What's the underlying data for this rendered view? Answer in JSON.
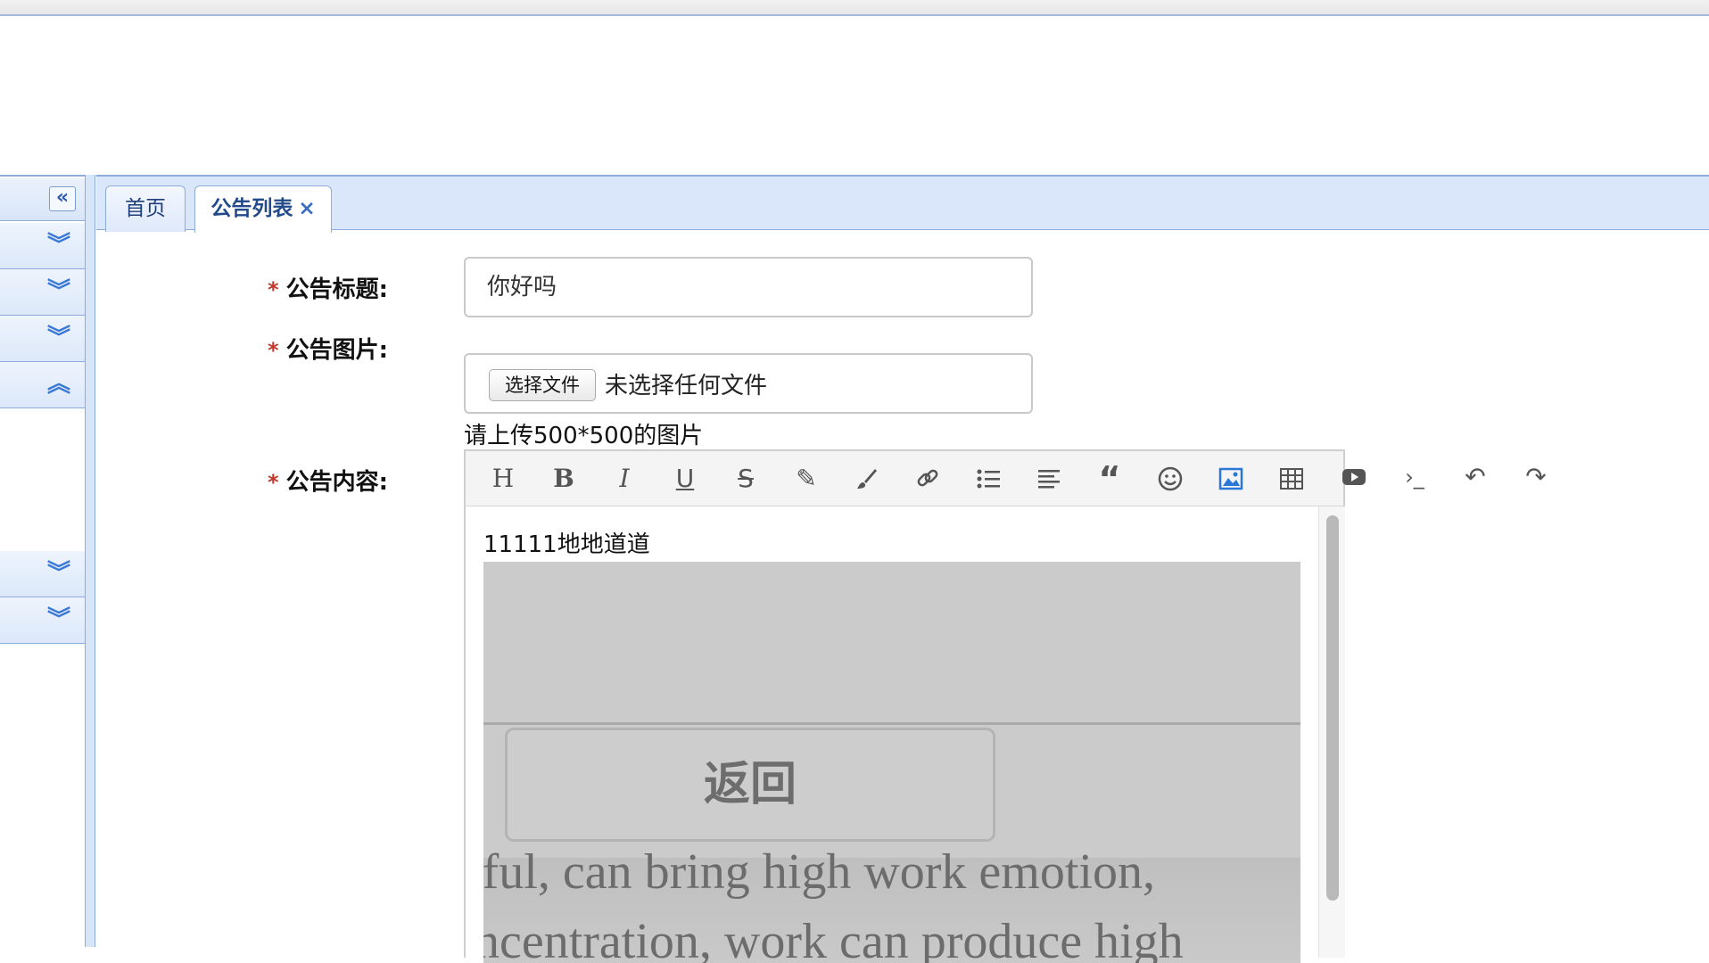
{
  "tabs": [
    {
      "label": "首页"
    },
    {
      "label": "公告列表",
      "close": "×"
    }
  ],
  "sidebar": {
    "collapse_icon": "double-chevron-left-icon",
    "items": [
      {
        "icon": "double-chevron-down-icon",
        "glyph": "⌄"
      },
      {
        "icon": "double-chevron-down-icon",
        "glyph": "⌄"
      },
      {
        "icon": "double-chevron-down-icon",
        "glyph": "⌄"
      },
      {
        "icon": "double-chevron-up-icon",
        "glyph": "⌃"
      },
      {
        "icon": "double-chevron-down-icon",
        "glyph": "⌄"
      },
      {
        "icon": "double-chevron-down-icon",
        "glyph": "⌄"
      }
    ]
  },
  "form": {
    "required_mark": "*",
    "title_label": "公告标题:",
    "title_value": "你好吗",
    "image_label": "公告图片:",
    "file_button": "选择文件",
    "file_status": "未选择任何文件",
    "image_hint": "请上传500*500的图片",
    "content_label": "公告内容:"
  },
  "editor": {
    "toolbar": [
      {
        "name": "heading-icon",
        "glyph": "H"
      },
      {
        "name": "bold-icon",
        "glyph": "B"
      },
      {
        "name": "italic-icon",
        "glyph": "I"
      },
      {
        "name": "underline-icon",
        "glyph": "U"
      },
      {
        "name": "strikethrough-icon",
        "glyph": "S"
      },
      {
        "name": "pen-icon",
        "glyph": "✎"
      },
      {
        "name": "brush-icon",
        "glyph": "🖌"
      },
      {
        "name": "link-icon",
        "glyph": "🔗"
      },
      {
        "name": "bullet-list-icon",
        "glyph": "☰"
      },
      {
        "name": "align-icon",
        "glyph": "≡"
      },
      {
        "name": "quote-icon",
        "glyph": "❝"
      },
      {
        "name": "emoji-icon",
        "glyph": "☺"
      },
      {
        "name": "image-icon",
        "glyph": "▣",
        "active": true
      },
      {
        "name": "table-icon",
        "glyph": "▦"
      },
      {
        "name": "video-icon",
        "glyph": "▶"
      },
      {
        "name": "code-icon",
        "glyph": "›_"
      },
      {
        "name": "undo-icon",
        "glyph": "↶"
      },
      {
        "name": "redo-icon",
        "glyph": "↷"
      }
    ],
    "content_text": "11111地地道道",
    "embedded_image": {
      "button_text": "返回",
      "line1": "rful, can bring high work emotion,",
      "line2": "ncentration, work can produce high"
    }
  },
  "colors": {
    "accent": "#2b77d8",
    "required": "#c0392b",
    "border_blue": "#8eacdb"
  }
}
